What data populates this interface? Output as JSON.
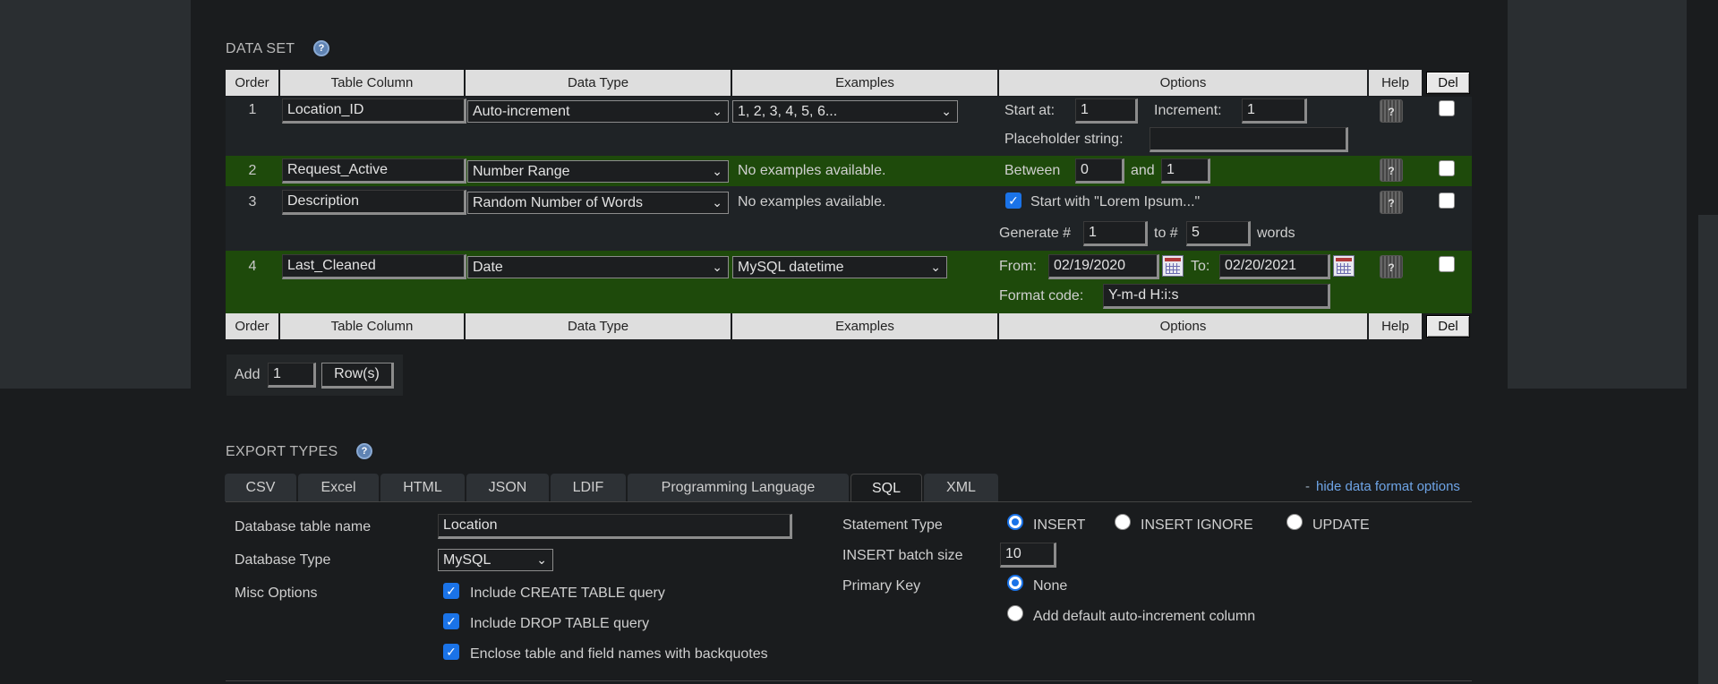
{
  "data_set": {
    "title": "DATA SET",
    "help_icon": "?",
    "columns": {
      "order": "Order",
      "table_column": "Table Column",
      "data_type": "Data Type",
      "examples": "Examples",
      "options": "Options",
      "help": "Help",
      "del": "Del"
    },
    "rows": [
      {
        "order": "1",
        "column_name": "Location_ID",
        "data_type": "Auto-increment",
        "example": "1, 2, 3, 4, 5, 6...",
        "opt_start_label": "Start at:",
        "opt_start_value": "1",
        "opt_increment_label": "Increment:",
        "opt_increment_value": "1",
        "opt_placeholder_label": "Placeholder string:",
        "opt_placeholder_value": ""
      },
      {
        "order": "2",
        "column_name": "Request_Active",
        "data_type": "Number Range",
        "example": "No examples available.",
        "opt_between_label": "Between",
        "opt_between_value": "0",
        "opt_and_label": "and",
        "opt_and_value": "1"
      },
      {
        "order": "3",
        "column_name": "Description",
        "data_type": "Random Number of Words",
        "example": "No examples available.",
        "opt_lorem_label": "Start with \"Lorem Ipsum...\"",
        "opt_generate_label": "Generate #",
        "opt_generate_value": "1",
        "opt_to_label": "to #",
        "opt_to_value": "5",
        "opt_words_label": "words"
      },
      {
        "order": "4",
        "column_name": "Last_Cleaned",
        "data_type": "Date",
        "example": "MySQL datetime",
        "opt_from_label": "From:",
        "opt_from_value": "02/19/2020",
        "opt_to_label": "To:",
        "opt_to_value": "02/20/2021",
        "opt_format_label": "Format code:",
        "opt_format_value": "Y-m-d H:i:s"
      }
    ],
    "help_button_icon": "?",
    "add_label": "Add",
    "add_value": "1",
    "rows_button": "Row(s)"
  },
  "export_types": {
    "title": "EXPORT TYPES",
    "help_icon": "?",
    "tabs": [
      "CSV",
      "Excel",
      "HTML",
      "JSON",
      "LDIF",
      "Programming Language",
      "SQL",
      "XML"
    ],
    "active_tab": "SQL",
    "hide_link": "hide data format options",
    "hide_link_prefix": "-",
    "db_table_name_label": "Database table name",
    "db_table_name_value": "Location",
    "db_type_label": "Database Type",
    "db_type_value": "MySQL",
    "misc_label": "Misc Options",
    "misc_options": [
      "Include CREATE TABLE query",
      "Include DROP TABLE query",
      "Enclose table and field names with backquotes"
    ],
    "statement_type_label": "Statement Type",
    "statement_options": [
      "INSERT",
      "INSERT IGNORE",
      "UPDATE"
    ],
    "batch_size_label": "INSERT batch size",
    "batch_size_value": "10",
    "primary_key_label": "Primary Key",
    "primary_key_options": [
      "None",
      "Add default auto-increment column"
    ]
  },
  "colors": {
    "green_row": "#1e4a0b",
    "dark_row": "#1f2326",
    "header_bg": "#dedede",
    "link": "#6ea4e6",
    "accent": "#1a73e8"
  }
}
